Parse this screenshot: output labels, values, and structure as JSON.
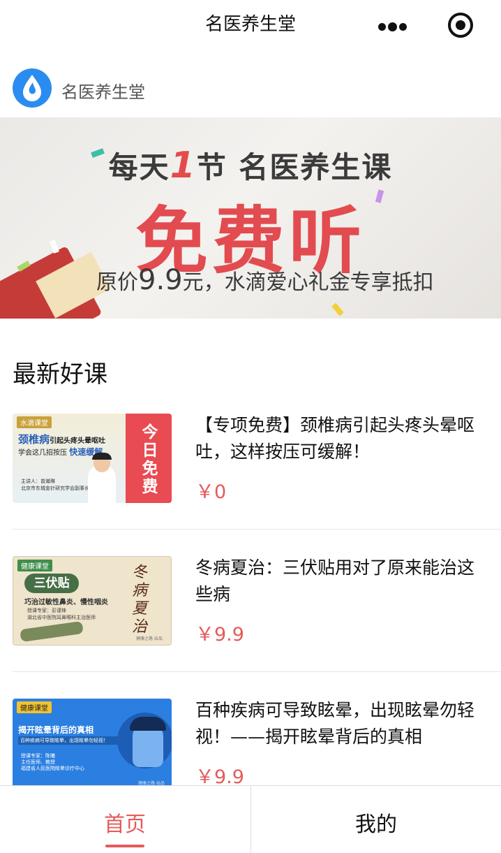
{
  "nav": {
    "title": "名医养生堂",
    "more_icon": "more-dots-icon",
    "close_icon": "target-circle-icon"
  },
  "brand": {
    "name": "名医养生堂",
    "logo_icon": "water-drop-logo"
  },
  "banner": {
    "line1_prefix": "每天",
    "line1_number": "1",
    "line1_suffix": "节 名医养生课",
    "line2": "免费听",
    "line3_prefix": "原价",
    "line3_price": "9.9",
    "line3_suffix": "元，水滴爱心礼金专享抵扣"
  },
  "section": {
    "title": "最新好课"
  },
  "courses": [
    {
      "title": "【专项免费】颈椎病引起头疼头晕呕吐，这样按压可缓解！",
      "price": "￥0",
      "thumb": {
        "tag": "水滴课堂",
        "headline": "颈椎病",
        "headline2": "引起头疼头晕呕吐",
        "sub": "学会这几招按压",
        "highlight": "快速缓解",
        "badge": "今日免费",
        "lecturer": "主讲人：曾瀚琳",
        "lecturer_title": "北京市东城金针研究学会副事长"
      }
    },
    {
      "title": "冬病夏治：三伏贴用对了原来能治这些病",
      "price": "￥9.9",
      "thumb": {
        "tag": "健康课堂",
        "headline": "三伏贴",
        "sub": "巧治过敏性鼻炎、慢性咽炎",
        "lecturer": "授课专家：彭谨锋",
        "lecturer_title": "湖北省中医院耳鼻喉科主治医师",
        "calligraphy": "冬病夏治",
        "footer": "健康之路 出品"
      }
    },
    {
      "title": "百种疾病可导致眩晕，出现眩晕勿轻视！——揭开眩晕背后的真相",
      "price": "￥9.9",
      "thumb": {
        "tag": "健康课堂",
        "headline": "揭开眩晕背后的真相",
        "sub": "百种疾病可导致眩晕，出现眩晕勿轻视！",
        "lecturer": "授课专家：陈曦",
        "lecturer_title": "主任医师、教授",
        "lecturer_org": "福建省人民医院眩晕诊疗中心",
        "footer": "健康之路 出品"
      }
    }
  ],
  "tabbar": {
    "home": "首页",
    "mine": "我的"
  },
  "colors": {
    "accent": "#e55a5a",
    "logo": "#2a8cf0"
  }
}
